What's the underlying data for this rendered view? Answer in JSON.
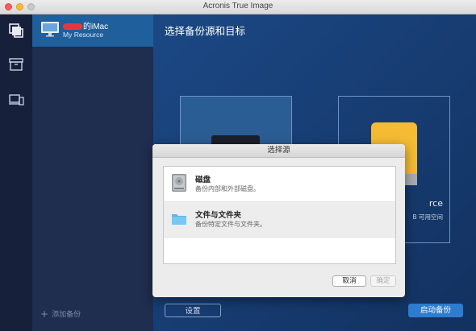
{
  "window": {
    "title": "Acronis True Image"
  },
  "rail": {
    "icons": [
      "copies-icon",
      "archive-icon",
      "devices-icon"
    ]
  },
  "sidebar": {
    "source": {
      "name": "的iMac",
      "subtitle": "My Resource"
    },
    "add_backup_label": "添加备份"
  },
  "main": {
    "title": "选择备份源和目标",
    "destination_title_partial": "rce",
    "destination_sub_partial": "B 可用空间",
    "settings_label": "设置",
    "start_label": "启动备份"
  },
  "dialog": {
    "title": "选择源",
    "items": [
      {
        "title": "磁盘",
        "desc": "备份内部和外部磁盘。"
      },
      {
        "title": "文件与文件夹",
        "desc": "备份特定文件与文件夹。"
      }
    ],
    "cancel_label": "取消",
    "ok_label": "确定"
  },
  "colors": {
    "accent": "#2d7ccf",
    "selected_source": "#1f5f9c",
    "drive": "#f4bb33"
  }
}
